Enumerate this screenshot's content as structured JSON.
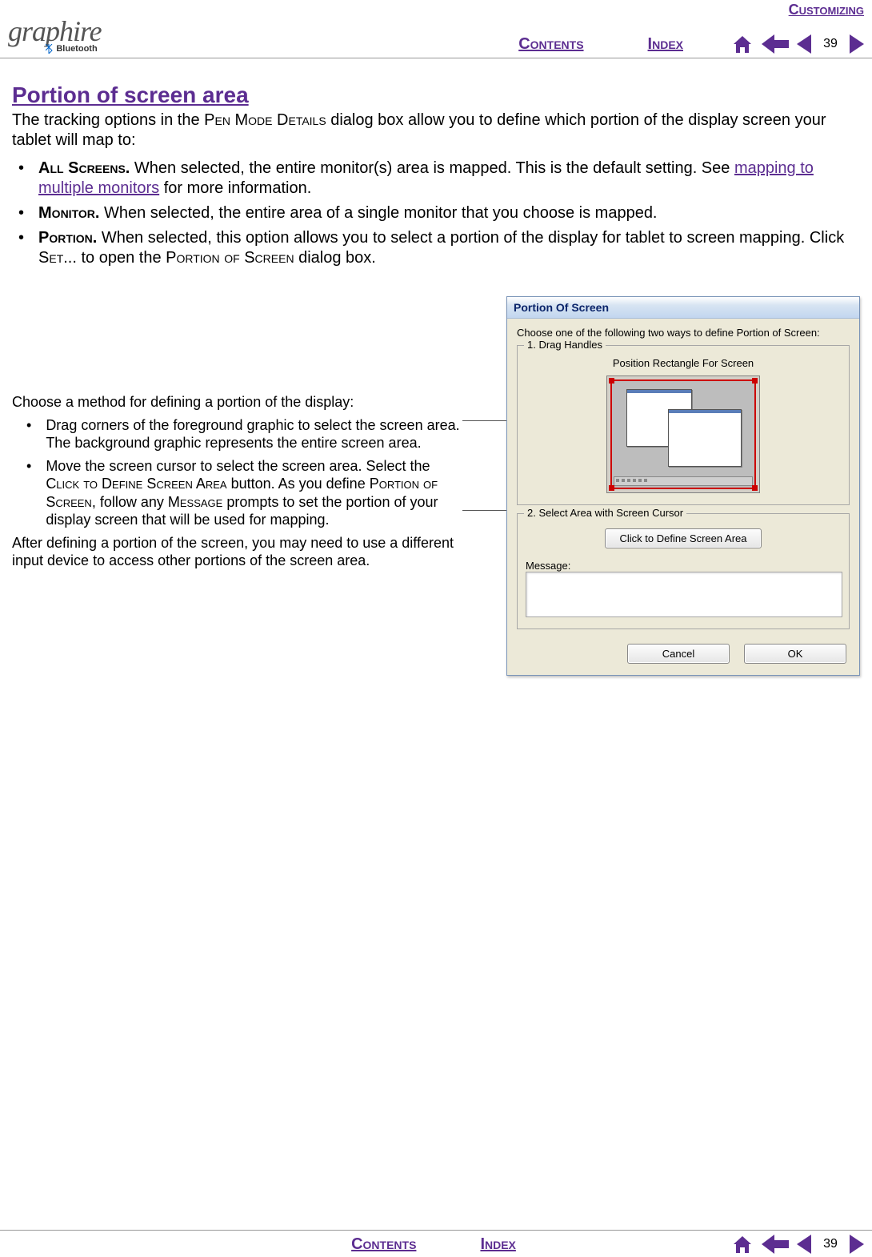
{
  "logo": {
    "main": "graphire",
    "sub": "Bluetooth"
  },
  "header": {
    "section_link": "Customizing",
    "contents": "Contents",
    "index": "Index",
    "page_num": "39"
  },
  "title": "Portion of screen area",
  "intro_pre": "The tracking options in the ",
  "intro_sc": "Pen Mode Details",
  "intro_post": " dialog box allow you to define which portion of the display screen your tablet will map to:",
  "bullets": [
    {
      "label": "All Screens.",
      "text1": "  When selected, the entire monitor(s) area is mapped.  This is the default setting. See ",
      "link": "mapping to multiple monitors",
      "text2": " for more information."
    },
    {
      "label": "Monitor.",
      "text1": "  When selected, the entire area of a single monitor that you choose is mapped.",
      "link": "",
      "text2": ""
    },
    {
      "label": "Portion.",
      "text1": "  When selected, this option allows you to select a portion of the display for tablet to screen mapping.  Click ",
      "sc2": "Set...",
      "text2": " to open the ",
      "sc3": "Portion of Screen",
      "text3": " dialog box."
    }
  ],
  "mid": {
    "heading": "Choose a method for defining a portion of the display:",
    "b1": "Drag corners of the foreground graphic to select the screen area.  The background graphic represents the entire screen area.",
    "b2_a": "Move the screen cursor to select the screen area. Select the ",
    "b2_sc1": "Click to Define Screen Area",
    "b2_b": " button.  As you define ",
    "b2_sc2": "Portion of Screen",
    "b2_c": ", follow any ",
    "b2_sc3": "Message",
    "b2_d": " prompts to set the portion of your display screen that will be used for mapping.",
    "after": "After defining a portion of the screen, you may need to use a different input device to access other portions of the screen area."
  },
  "dialog": {
    "title": "Portion Of Screen",
    "instr": "Choose one of the following two ways to define Portion of Screen:",
    "group1": "1. Drag Handles",
    "position": "Position Rectangle For Screen",
    "group2": "2. Select Area with Screen Cursor",
    "click_btn": "Click to Define Screen Area",
    "message_label": "Message:",
    "cancel": "Cancel",
    "ok": "OK"
  },
  "footer": {
    "contents": "Contents",
    "index": "Index",
    "page_num": "39"
  }
}
